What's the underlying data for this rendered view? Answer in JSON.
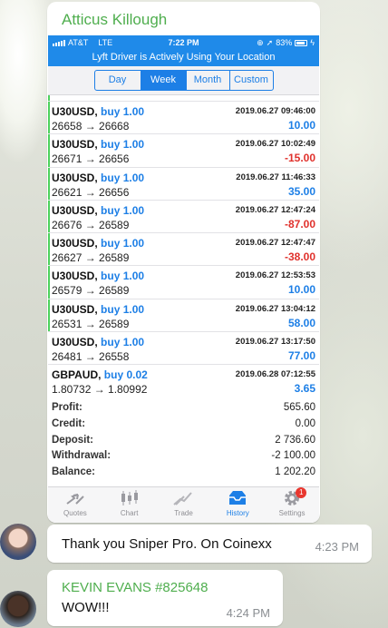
{
  "chat": {
    "sender_name": "Atticus Killough",
    "messages": [
      {
        "text": "Thank you Sniper Pro. On Coinexx",
        "time": "4:23 PM"
      },
      {
        "name": "KEVIN EVANS #825648",
        "text": "WOW!!!",
        "time": "4:24 PM"
      }
    ]
  },
  "phone": {
    "carrier": "AT&T",
    "network": "LTE",
    "clock": "7:22 PM",
    "battery": "83%",
    "location_banner": "Lyft Driver is Actively Using Your Location",
    "period_tabs": [
      "Day",
      "Week",
      "Month",
      "Custom"
    ],
    "active_tab": "Week",
    "trades": [
      {
        "symbol": "U30USD,",
        "direction": "buy 1.00",
        "prices": "26658 → 26668",
        "time": "2019.06.27 09:46:00",
        "profit": "10.00",
        "sign": "pos"
      },
      {
        "symbol": "U30USD,",
        "direction": "buy 1.00",
        "prices": "26671 → 26656",
        "time": "2019.06.27 10:02:49",
        "profit": "-15.00",
        "sign": "neg"
      },
      {
        "symbol": "U30USD,",
        "direction": "buy 1.00",
        "prices": "26621 → 26656",
        "time": "2019.06.27 11:46:33",
        "profit": "35.00",
        "sign": "pos"
      },
      {
        "symbol": "U30USD,",
        "direction": "buy 1.00",
        "prices": "26676 → 26589",
        "time": "2019.06.27 12:47:24",
        "profit": "-87.00",
        "sign": "neg"
      },
      {
        "symbol": "U30USD,",
        "direction": "buy 1.00",
        "prices": "26627 → 26589",
        "time": "2019.06.27 12:47:47",
        "profit": "-38.00",
        "sign": "neg"
      },
      {
        "symbol": "U30USD,",
        "direction": "buy 1.00",
        "prices": "26579 → 26589",
        "time": "2019.06.27 12:53:53",
        "profit": "10.00",
        "sign": "pos"
      },
      {
        "symbol": "U30USD,",
        "direction": "buy 1.00",
        "prices": "26531 → 26589",
        "time": "2019.06.27 13:04:12",
        "profit": "58.00",
        "sign": "pos"
      },
      {
        "symbol": "U30USD,",
        "direction": "buy 1.00",
        "prices": "26481 → 26558",
        "time": "2019.06.27 13:17:50",
        "profit": "77.00",
        "sign": "pos"
      },
      {
        "symbol": "GBPAUD,",
        "direction": "buy 0.02",
        "prices": "1.80732 → 1.80992",
        "time": "2019.06.28 07:12:55",
        "profit": "3.65",
        "sign": "pos"
      }
    ],
    "summary": [
      {
        "label": "Profit:",
        "value": "565.60"
      },
      {
        "label": "Credit:",
        "value": "0.00"
      },
      {
        "label": "Deposit:",
        "value": "2 736.60"
      },
      {
        "label": "Withdrawal:",
        "value": "-2 100.00"
      },
      {
        "label": "Balance:",
        "value": "1 202.20"
      }
    ],
    "nav": [
      {
        "label": "Quotes",
        "icon": "quotes-icon"
      },
      {
        "label": "Chart",
        "icon": "candlestick-icon"
      },
      {
        "label": "Trade",
        "icon": "trade-icon"
      },
      {
        "label": "History",
        "icon": "history-inbox-icon"
      },
      {
        "label": "Settings",
        "icon": "gear-icon",
        "badge": "1"
      }
    ],
    "active_nav": "History"
  },
  "colors": {
    "accent_blue": "#1d7fe6",
    "loss_red": "#e0312c",
    "telegram_name_green": "#4fae4e",
    "status_green_bar": "#4cd25c"
  }
}
